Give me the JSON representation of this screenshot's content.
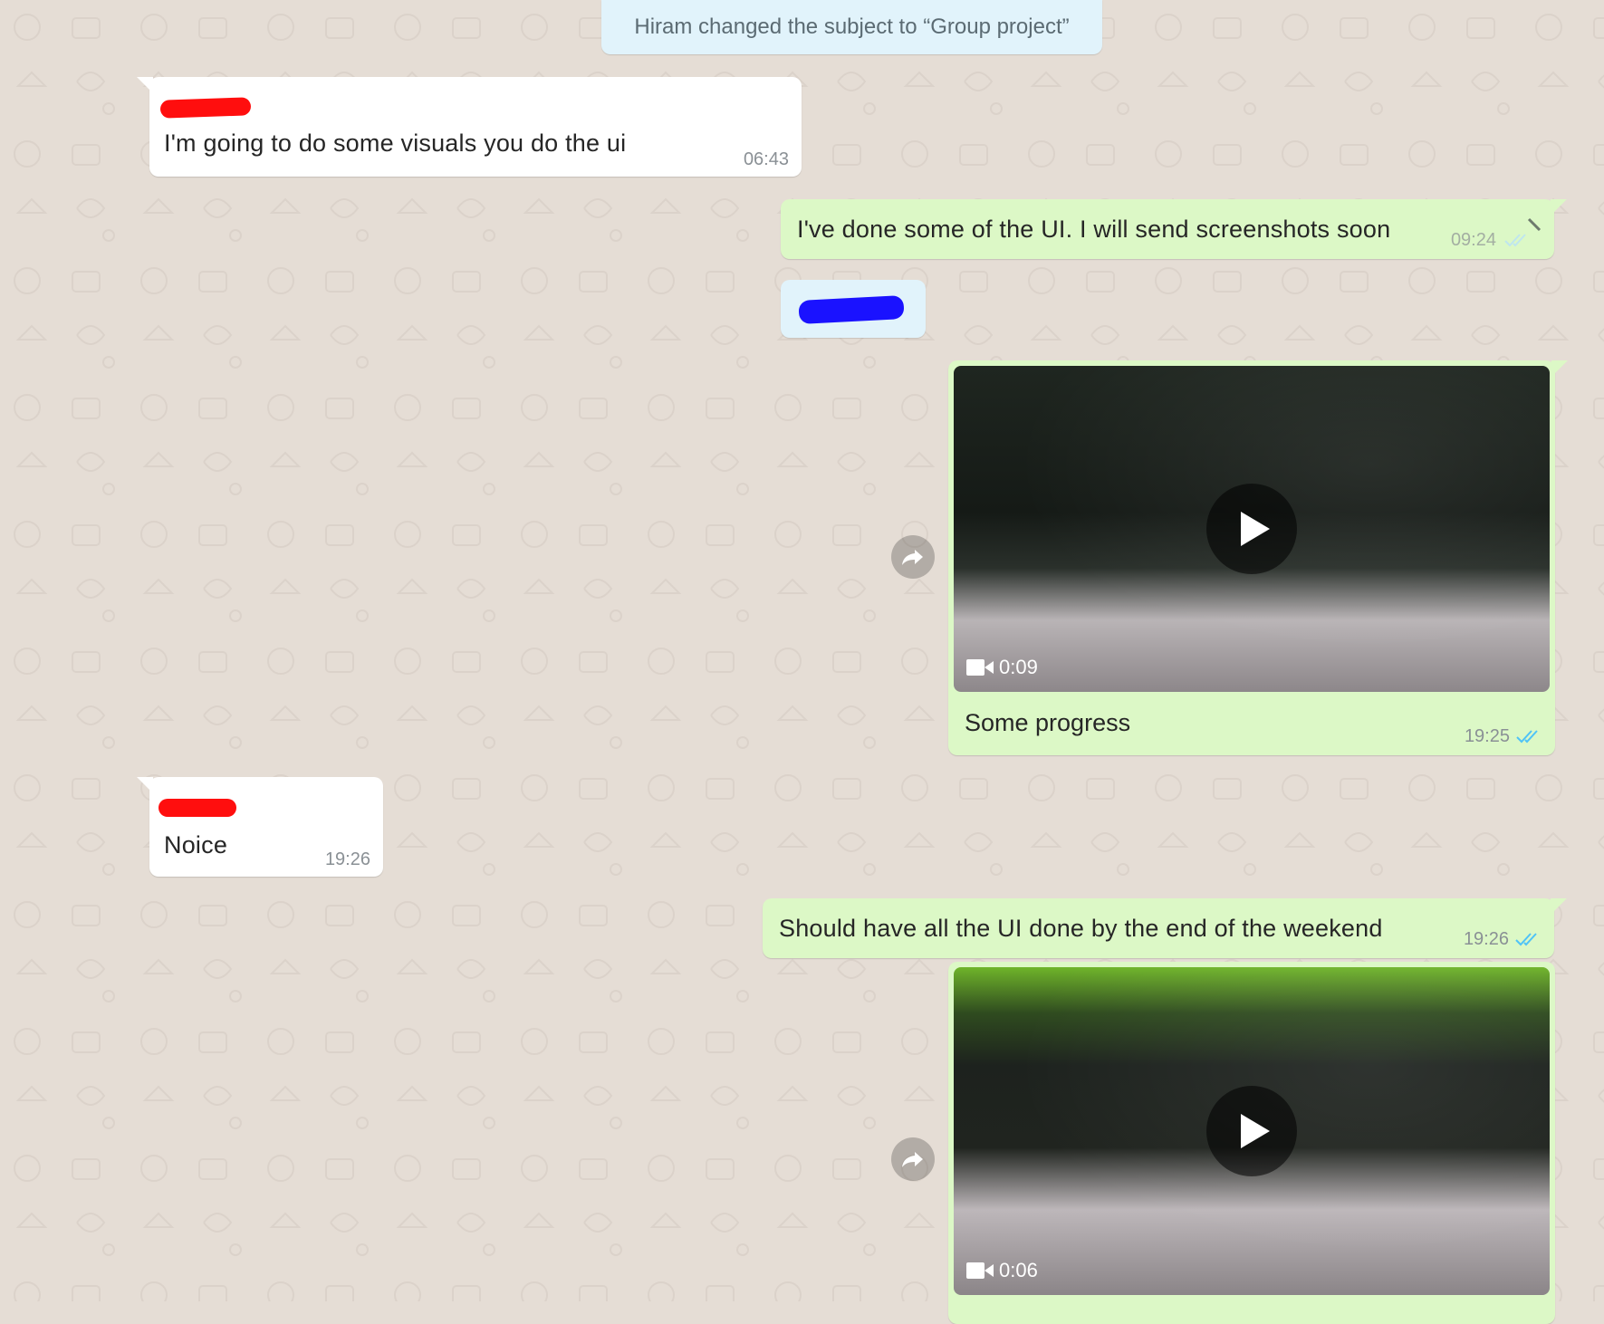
{
  "system_notice": "Hiram changed the subject to “Group project”",
  "messages": [
    {
      "direction": "incoming",
      "text": "I'm going to do some visuals you do the ui",
      "time": "06:43"
    },
    {
      "direction": "outgoing",
      "text": "I've done some of the UI. I will send screenshots soon",
      "time": "09:24"
    },
    {
      "direction": "outgoing",
      "type": "video",
      "duration": "0:09",
      "caption": "Some progress",
      "time": "19:25"
    },
    {
      "direction": "incoming",
      "text": "Noice",
      "time": "19:26"
    },
    {
      "direction": "outgoing",
      "text": "Should have all the UI done by the end of the weekend",
      "time": "19:26"
    },
    {
      "direction": "outgoing",
      "type": "video",
      "duration": "0:06"
    }
  ],
  "icons": {
    "read_ticks": "double-check-icon",
    "forward": "forward-arrow-icon",
    "play": "play-icon",
    "camera": "video-camera-icon"
  },
  "colors": {
    "background": "#e5ddd5",
    "incoming_bubble": "#ffffff",
    "outgoing_bubble": "#dcf8c6",
    "system_bubble": "#e1f3fb",
    "read_ticks": "#4fc3f7"
  }
}
